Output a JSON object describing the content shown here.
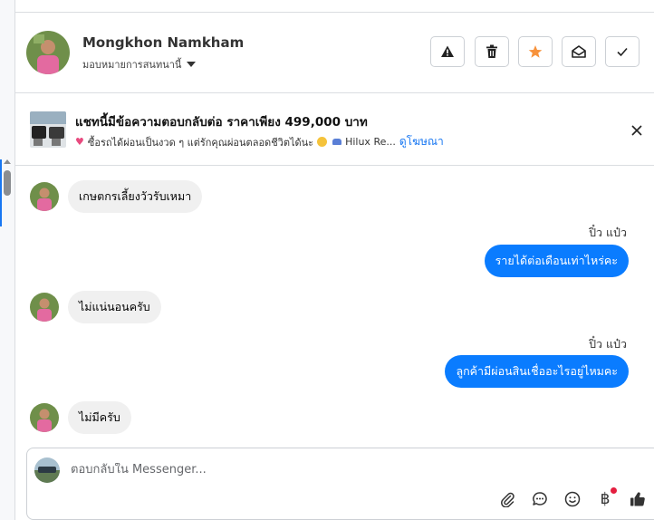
{
  "header": {
    "name": "Mongkhon Namkham",
    "assign_label": "มอบหมายการสนทนานี้",
    "buttons": [
      {
        "name": "report-button",
        "icon": "warning-icon"
      },
      {
        "name": "delete-button",
        "icon": "trash-icon"
      },
      {
        "name": "star-button",
        "icon": "star-icon"
      },
      {
        "name": "mark-unread-button",
        "icon": "envelope-open-icon"
      },
      {
        "name": "done-button",
        "icon": "check-icon"
      }
    ]
  },
  "ad": {
    "title": "แชทนี้มีข้อความตอบกลับต่อ ราคาเพียง 499,000 บาท",
    "subtitle": "ซื้อรถได้ผ่อนเป็นงวด ๆ แต่รักคุณผ่อนตลอดชีวิตได้นะ",
    "subtitle_suffix": "Hilux Re...",
    "link": "ดูโฆษณา"
  },
  "messages": [
    {
      "direction": "in",
      "text": "เกษตกรเลี้ยงวัวรับเหมา"
    },
    {
      "direction": "out",
      "sender": "ปิ๋ว แป๋ว",
      "text": "รายได้ต่อเดือนเท่าไหร่คะ"
    },
    {
      "direction": "in",
      "text": "ไม่แน่นอนครับ"
    },
    {
      "direction": "out",
      "sender": "ปิ๋ว แป๋ว",
      "text": "ลูกค้ามีผ่อนสินเชื่ออะไรอยู่ไหมคะ"
    },
    {
      "direction": "in",
      "text": "ไม่มีครับ"
    }
  ],
  "composer": {
    "placeholder": "ตอบกลับใน Messenger...",
    "tools": [
      "paperclip-icon",
      "chat-bubble-icon",
      "smiley-icon",
      "baht-icon",
      "thumbs-up-icon"
    ],
    "baht_symbol": "฿"
  },
  "colors": {
    "accent": "#0a7cff",
    "link": "#1877f2",
    "star": "#f7923b",
    "notification_dot": "#e41e3f"
  }
}
